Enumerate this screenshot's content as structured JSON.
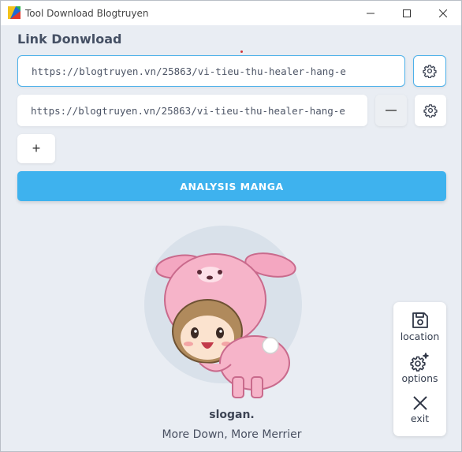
{
  "window": {
    "title": "Tool Download Blogtruyen",
    "controls": [
      "minimize-icon",
      "maximize-icon",
      "close-icon"
    ]
  },
  "main": {
    "heading": "Link Donwload",
    "links": [
      {
        "value": "https://blogtruyen.vn/25863/vi-tieu-thu-healer-hang-e",
        "active": true,
        "buttons": [
          "gear-icon"
        ]
      },
      {
        "value": "https://blogtruyen.vn/25863/vi-tieu-thu-healer-hang-e",
        "active": false,
        "buttons": [
          "minus-icon",
          "gear-icon"
        ]
      }
    ],
    "add_label": "+",
    "analysis_label": "ANALYSIS MANGA",
    "slogan_title": "slogan.",
    "slogan_text": "More Down, More Merrier"
  },
  "side_panel": {
    "items": [
      {
        "label": "location",
        "icon": "save-icon"
      },
      {
        "label": "options",
        "icon": "gears-icon"
      },
      {
        "label": "exit",
        "icon": "x-icon"
      }
    ]
  },
  "colors": {
    "accent": "#3eb2ee",
    "background": "#e9edf3",
    "text": "#455064"
  }
}
